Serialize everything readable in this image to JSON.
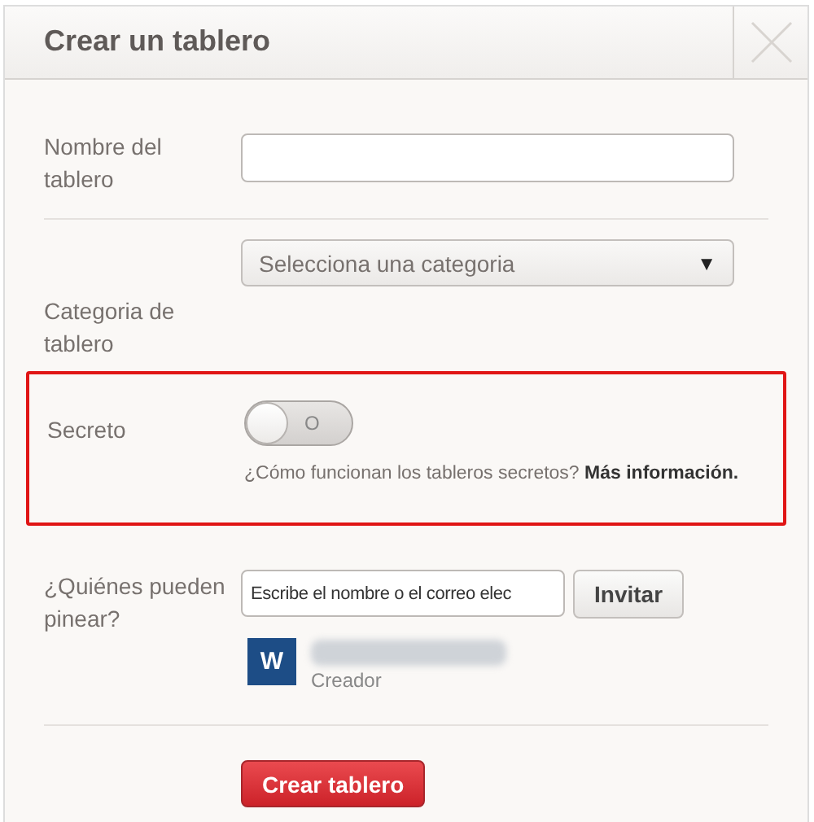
{
  "dialog": {
    "title": "Crear un tablero"
  },
  "fields": [
    {
      "kind": "text",
      "label": "Nombre del tablero"
    },
    {
      "kind": "select",
      "label": "Categoria de tablero",
      "placeholder": "Selecciona una categoria",
      "caret": "▼"
    },
    {
      "kind": "toggle",
      "label": "Secreto",
      "on": false,
      "toggle_text": "O",
      "help": "¿Cómo funcionan los tableros secretos? **Más información.**",
      "highlighted": true
    },
    {
      "kind": "invite",
      "label": "¿Quiénes pueden pinear?",
      "placeholder": "Escribe el nombre o el correo elec",
      "button": "Invitar",
      "member": {
        "initial": "W",
        "role": "Creador"
      }
    }
  ],
  "submit": "Crear tablero"
}
